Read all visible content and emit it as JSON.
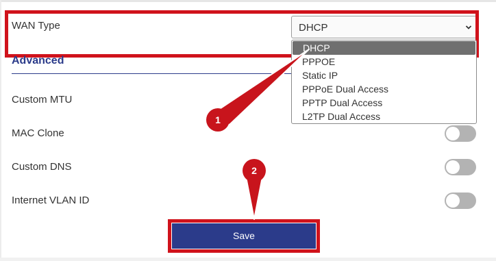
{
  "wan_type": {
    "label": "WAN Type",
    "selected_value": "DHCP",
    "chevron_glyph": "⌄",
    "options": [
      "DHCP",
      "PPPOE",
      "Static IP",
      "PPPoE Dual Access",
      "PPTP Dual Access",
      "L2TP Dual Access"
    ]
  },
  "advanced": {
    "title": "Advanced",
    "rows": [
      {
        "label": "Custom MTU"
      },
      {
        "label": "MAC Clone",
        "toggle_on": false
      },
      {
        "label": "Custom DNS",
        "toggle_on": false
      },
      {
        "label": "Internet VLAN ID",
        "toggle_on": false
      }
    ]
  },
  "save_label": "Save",
  "annotations": {
    "step1": "1",
    "step2": "2",
    "color": "#d0121b"
  },
  "colors": {
    "brand": "#2b3b8a",
    "toggle_off": "#b3b3b3",
    "dropdown_highlight": "#6f6f6f"
  }
}
